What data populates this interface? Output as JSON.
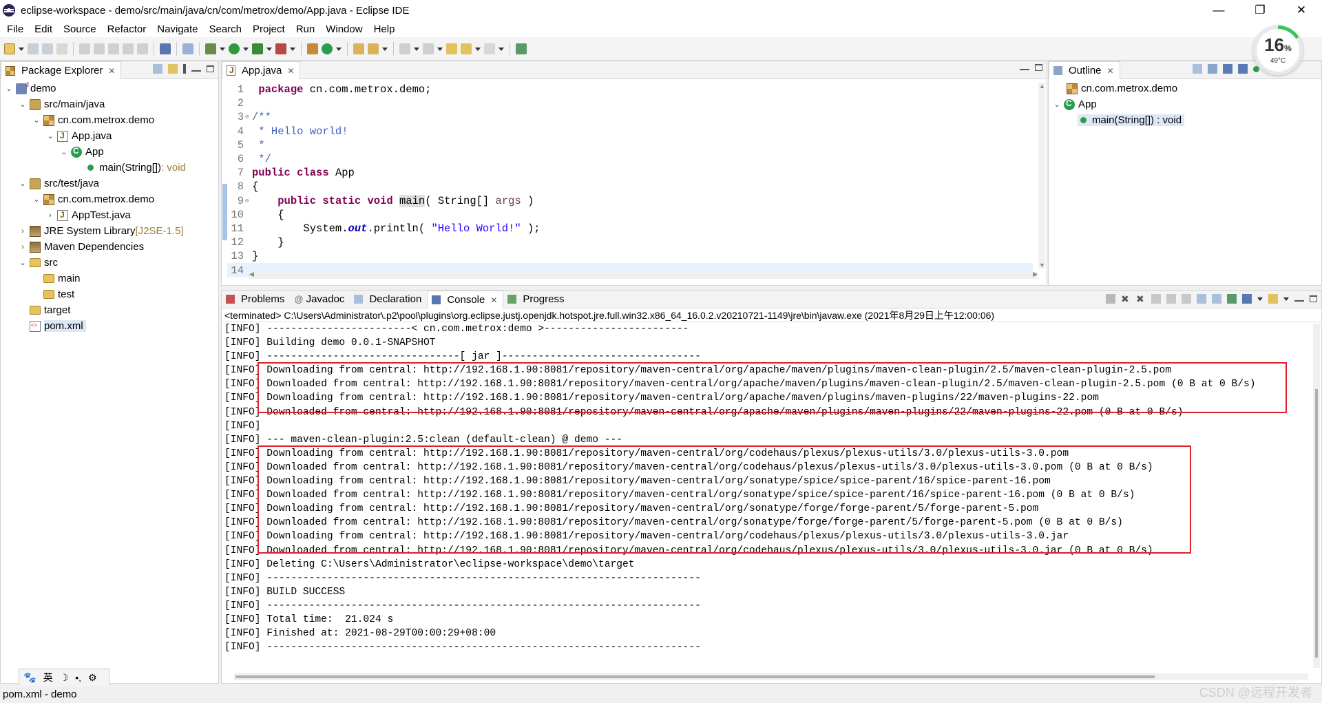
{
  "window": {
    "title": "eclipse-workspace - demo/src/main/java/cn/com/metrox/demo/App.java - Eclipse IDE",
    "controls": {
      "minimize": "—",
      "restore": "❐",
      "close": "✕"
    }
  },
  "menu": [
    "File",
    "Edit",
    "Source",
    "Refactor",
    "Navigate",
    "Search",
    "Project",
    "Run",
    "Window",
    "Help"
  ],
  "gauge": {
    "percent": "16",
    "unit": "%",
    "temp": "49°C",
    "fraction": 0.16
  },
  "package_explorer": {
    "tab": "Package Explorer",
    "tree": [
      {
        "label": "demo",
        "icon": "project-icon"
      },
      {
        "label": "src/main/java",
        "icon": "source-folder-icon"
      },
      {
        "label": "cn.com.metrox.demo",
        "icon": "package-icon"
      },
      {
        "label": "App.java",
        "icon": "java-file-icon"
      },
      {
        "label": "App",
        "icon": "class-icon"
      },
      {
        "label": "main(String[])",
        "suffix": " : void",
        "icon": "method-icon"
      },
      {
        "label": "src/test/java",
        "icon": "source-folder-icon"
      },
      {
        "label": "cn.com.metrox.demo",
        "icon": "package-icon"
      },
      {
        "label": "AppTest.java",
        "icon": "java-file-icon"
      },
      {
        "label": "JRE System Library",
        "suffix": " [J2SE-1.5]",
        "icon": "library-icon"
      },
      {
        "label": "Maven Dependencies",
        "icon": "library-icon"
      },
      {
        "label": "src",
        "icon": "folder-icon"
      },
      {
        "label": "main",
        "icon": "folder-icon"
      },
      {
        "label": "test",
        "icon": "folder-icon"
      },
      {
        "label": "target",
        "icon": "folder-icon"
      },
      {
        "label": "pom.xml",
        "icon": "xml-file-icon"
      }
    ]
  },
  "editor": {
    "tab": "App.java",
    "line_numbers": [
      "1",
      "2",
      "3",
      "4",
      "5",
      "6",
      "7",
      "8",
      "9",
      "10",
      "11",
      "12",
      "13",
      "14"
    ],
    "code": {
      "l1_kw": "package",
      "l1_rest": " cn.com.metrox.demo;",
      "l3": "/**",
      "l4": " * Hello world!",
      "l5": " *",
      "l6": " */",
      "l7_kw1": "public",
      "l7_kw2": "class",
      "l7_name": " App",
      "l8": "{",
      "l9_kw1": "public",
      "l9_kw2": "static",
      "l9_kw3": "void",
      "l9_method": "main",
      "l9_mid": "( String[] ",
      "l9_arg": "args",
      "l9_end": " )",
      "l10": "    {",
      "l11_pre": "        System.",
      "l11_field": "out",
      "l11_mid": ".println( ",
      "l11_str": "\"Hello World!\"",
      "l11_end": " );",
      "l12": "    }",
      "l13": "}"
    }
  },
  "outline": {
    "tab": "Outline",
    "items": [
      {
        "label": "cn.com.metrox.demo"
      },
      {
        "label": "App"
      },
      {
        "label": "main(String[]) : void"
      }
    ]
  },
  "bottom": {
    "tabs": [
      "Problems",
      "Javadoc",
      "Declaration",
      "Console",
      "Progress"
    ],
    "terminated": "<terminated> C:\\Users\\Administrator\\.p2\\pool\\plugins\\org.eclipse.justj.openjdk.hotspot.jre.full.win32.x86_64_16.0.2.v20210721-1149\\jre\\bin\\javaw.exe  (2021年8月29日上午12:00:06)",
    "console_lines": [
      "[INFO] ------------------------< cn.com.metrox:demo >------------------------",
      "[INFO] Building demo 0.0.1-SNAPSHOT",
      "[INFO] --------------------------------[ jar ]---------------------------------",
      "[INFO] Downloading from central: http://192.168.1.90:8081/repository/maven-central/org/apache/maven/plugins/maven-clean-plugin/2.5/maven-clean-plugin-2.5.pom",
      "[INFO] Downloaded from central: http://192.168.1.90:8081/repository/maven-central/org/apache/maven/plugins/maven-clean-plugin/2.5/maven-clean-plugin-2.5.pom (0 B at 0 B/s)",
      "[INFO] Downloading from central: http://192.168.1.90:8081/repository/maven-central/org/apache/maven/plugins/maven-plugins/22/maven-plugins-22.pom",
      "[INFO] Downloaded from central: http://192.168.1.90:8081/repository/maven-central/org/apache/maven/plugins/maven-plugins/22/maven-plugins-22.pom (0 B at 0 B/s)",
      "[INFO]",
      "[INFO] --- maven-clean-plugin:2.5:clean (default-clean) @ demo ---",
      "[INFO] Downloading from central: http://192.168.1.90:8081/repository/maven-central/org/codehaus/plexus/plexus-utils/3.0/plexus-utils-3.0.pom",
      "[INFO] Downloaded from central: http://192.168.1.90:8081/repository/maven-central/org/codehaus/plexus/plexus-utils/3.0/plexus-utils-3.0.pom (0 B at 0 B/s)",
      "[INFO] Downloading from central: http://192.168.1.90:8081/repository/maven-central/org/sonatype/spice/spice-parent/16/spice-parent-16.pom",
      "[INFO] Downloaded from central: http://192.168.1.90:8081/repository/maven-central/org/sonatype/spice/spice-parent/16/spice-parent-16.pom (0 B at 0 B/s)",
      "[INFO] Downloading from central: http://192.168.1.90:8081/repository/maven-central/org/sonatype/forge/forge-parent/5/forge-parent-5.pom",
      "[INFO] Downloaded from central: http://192.168.1.90:8081/repository/maven-central/org/sonatype/forge/forge-parent/5/forge-parent-5.pom (0 B at 0 B/s)",
      "[INFO] Downloading from central: http://192.168.1.90:8081/repository/maven-central/org/codehaus/plexus/plexus-utils/3.0/plexus-utils-3.0.jar",
      "[INFO] Downloaded from central: http://192.168.1.90:8081/repository/maven-central/org/codehaus/plexus/plexus-utils/3.0/plexus-utils-3.0.jar (0 B at 0 B/s)",
      "[INFO] Deleting C:\\Users\\Administrator\\eclipse-workspace\\demo\\target",
      "[INFO] ------------------------------------------------------------------------",
      "[INFO] BUILD SUCCESS",
      "[INFO] ------------------------------------------------------------------------",
      "[INFO] Total time:  21.024 s",
      "[INFO] Finished at: 2021-08-29T00:00:29+08:00",
      "[INFO] ------------------------------------------------------------------------"
    ]
  },
  "ime": {
    "lang": "英",
    "moon": "☽",
    "punct": "•,",
    "gear": "⚙"
  },
  "status": {
    "text": "pom.xml - demo"
  },
  "watermark": "CSDN @远程开发者",
  "colors": {
    "highlight_box": "#e0202a",
    "keyword": "#7f0055",
    "comment": "#3f5fbf",
    "string": "#2a00ff"
  }
}
